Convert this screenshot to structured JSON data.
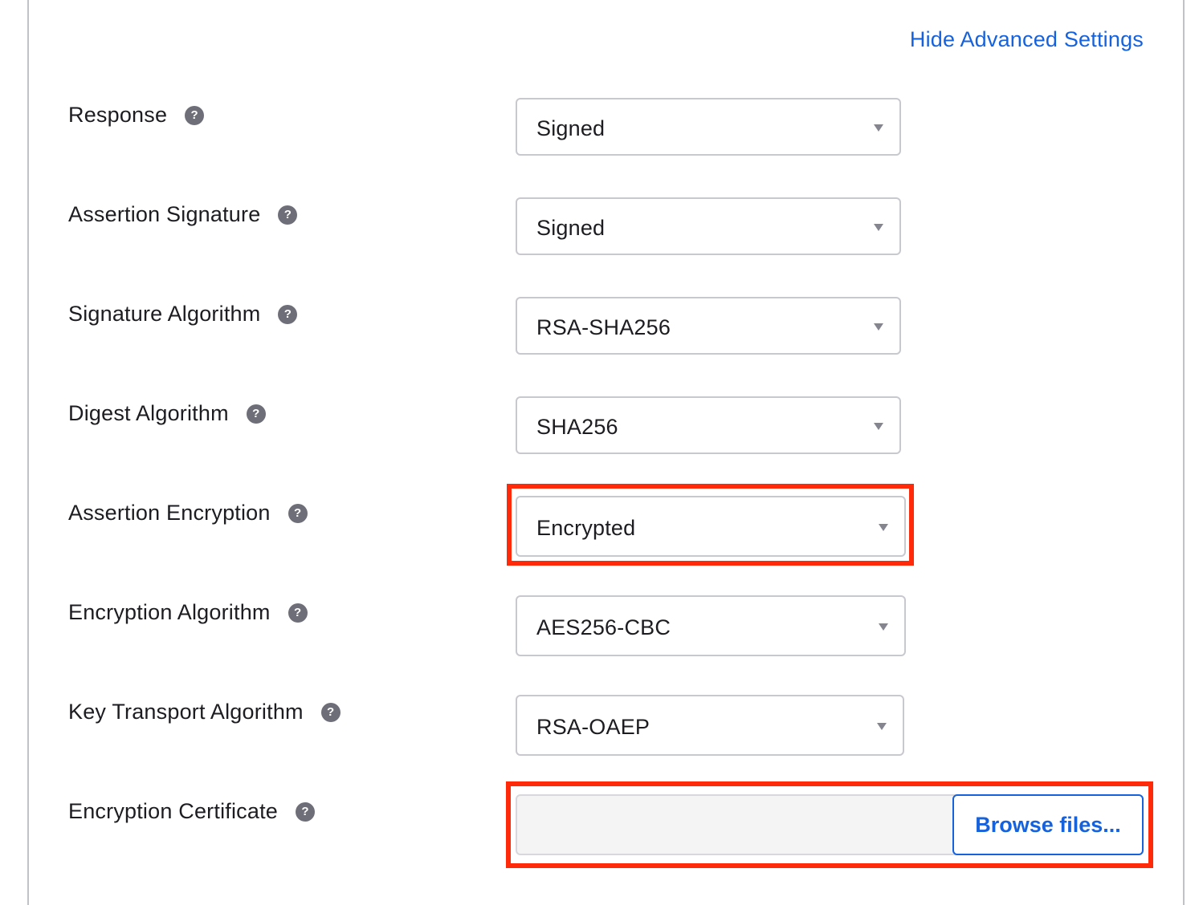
{
  "toggle_link": "Hide Advanced Settings",
  "help_glyph": "?",
  "fields": [
    {
      "label": "Response",
      "value": "Signed",
      "icon": "help-icon"
    },
    {
      "label": "Assertion Signature",
      "value": "Signed",
      "icon": "help-icon"
    },
    {
      "label": "Signature Algorithm",
      "value": "RSA-SHA256",
      "icon": "help-icon"
    },
    {
      "label": "Digest Algorithm",
      "value": "SHA256",
      "icon": "help-icon"
    },
    {
      "label": "Assertion Encryption",
      "value": "Encrypted",
      "icon": "help-icon",
      "highlighted": true
    },
    {
      "label": "Encryption Algorithm",
      "value": "AES256-CBC",
      "icon": "help-icon"
    },
    {
      "label": "Key Transport Algorithm",
      "value": "RSA-OAEP",
      "icon": "help-icon"
    }
  ],
  "certificate": {
    "label": "Encryption Certificate",
    "file_value": "",
    "browse_label": "Browse files...",
    "highlighted": true
  },
  "colors": {
    "link": "#1662dd",
    "highlight": "#ff2a0a",
    "help_icon": "#6e6e78"
  }
}
